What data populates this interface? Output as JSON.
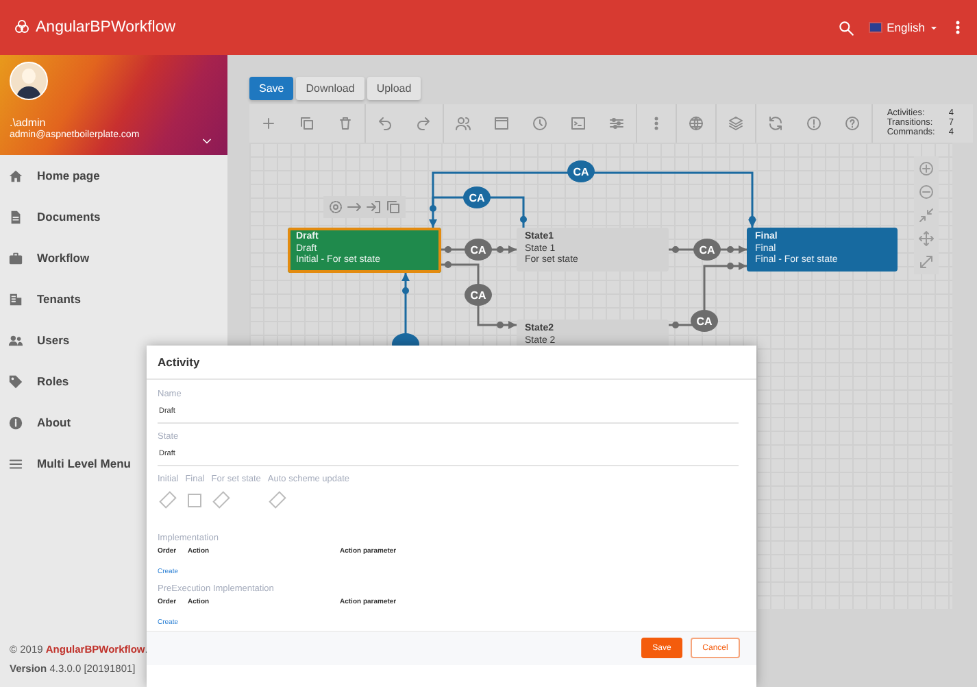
{
  "app": {
    "title": "AngularBPWorkflow",
    "language": "English"
  },
  "user": {
    "name": ".\\admin",
    "email": "admin@aspnetboilerplate.com"
  },
  "menu": [
    {
      "label": "Home page"
    },
    {
      "label": "Documents"
    },
    {
      "label": "Workflow"
    },
    {
      "label": "Tenants"
    },
    {
      "label": "Users"
    },
    {
      "label": "Roles"
    },
    {
      "label": "About"
    },
    {
      "label": "Multi Level Menu"
    }
  ],
  "footer": {
    "prefix": "© 2019 ",
    "brand": "AngularBPWorkflow",
    "suffix": ".",
    "version": "**Version** 4.3.0.0 [20191801]"
  },
  "designer": {
    "buttons": [
      {
        "label": "Save",
        "primary": true
      },
      {
        "label": "Download",
        "primary": false
      },
      {
        "label": "Upload",
        "primary": false
      }
    ],
    "stats": [
      {
        "label": "Activities:",
        "value": "4"
      },
      {
        "label": "Transitions:",
        "value": "7"
      },
      {
        "label": "Commands:",
        "value": "4"
      }
    ],
    "nodes": [
      {
        "kind": "initial",
        "selected": true,
        "lines": [
          "Draft",
          "Draft",
          "Initial - For set state"
        ]
      },
      {
        "kind": "normal",
        "selected": false,
        "lines": [
          "State1",
          "State 1",
          "For set state"
        ]
      },
      {
        "kind": "final",
        "selected": false,
        "lines": [
          "Final",
          "Final",
          "Final - For set state"
        ]
      },
      {
        "kind": "normal",
        "selected": false,
        "lines": [
          "State2",
          "State 2"
        ]
      }
    ],
    "transitions": [
      {
        "label": "CA",
        "color": "#1b6aa0"
      },
      {
        "label": "CA",
        "color": "#1b6aa0"
      },
      {
        "label": "CA",
        "color": "#6d6d6d"
      },
      {
        "label": "CA",
        "color": "#6d6d6d"
      },
      {
        "label": "CA",
        "color": "#6d6d6d"
      },
      {
        "label": "CA",
        "color": "#6d6d6d"
      },
      {
        "color": "#1b6aa0"
      }
    ]
  },
  "modal": {
    "title": "Activity",
    "fields": [
      {
        "label": "Name",
        "value": "Draft"
      },
      {
        "label": "State",
        "value": "Draft"
      }
    ],
    "flags": [
      {
        "label": "Initial",
        "checked": true
      },
      {
        "label": "Final",
        "checked": false
      },
      {
        "label": "For set state",
        "checked": true
      },
      {
        "label": "Auto scheme update",
        "checked": true
      }
    ],
    "sections": [
      {
        "title": "Implementation",
        "columns": [
          "Order",
          "Action",
          "Action parameter"
        ],
        "link": "Create"
      },
      {
        "title": "PreExecution Implementation",
        "columns": [
          "Order",
          "Action",
          "Action parameter"
        ],
        "link": "Create"
      }
    ],
    "buttons": [
      {
        "label": "Save",
        "kind": "primary"
      },
      {
        "label": "Cancel",
        "kind": "secondary"
      }
    ]
  }
}
